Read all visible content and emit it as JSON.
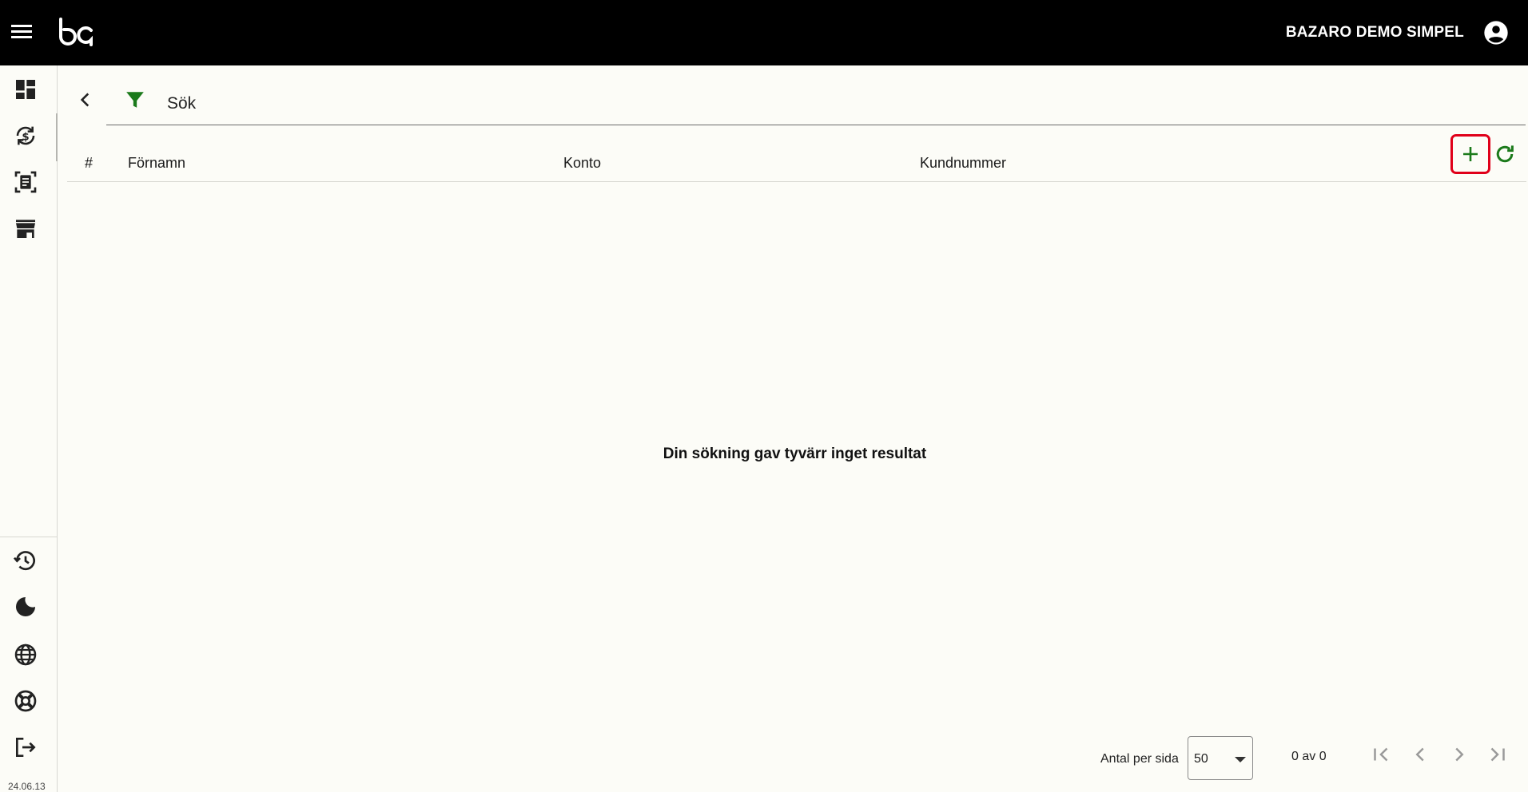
{
  "header": {
    "org_name": "BAZARO DEMO SIMPEL",
    "icons": {
      "menu": "menu-icon",
      "logo": "ba-logo",
      "account": "account-circle-icon"
    }
  },
  "sidebar": {
    "top_items": [
      {
        "icon": "dashboard-icon"
      },
      {
        "icon": "currency-exchange-icon"
      },
      {
        "icon": "document-scan-icon"
      },
      {
        "icon": "storefront-icon"
      }
    ],
    "bottom_items": [
      {
        "icon": "history-icon"
      },
      {
        "icon": "dark-mode-icon"
      },
      {
        "icon": "language-globe-icon"
      },
      {
        "icon": "support-lifebuoy-icon"
      },
      {
        "icon": "logout-icon"
      }
    ],
    "version": "24.06.13"
  },
  "search": {
    "label": "Sök"
  },
  "table": {
    "columns": [
      "#",
      "Förnamn",
      "Konto",
      "Kundnummer"
    ],
    "rows": [],
    "empty_message": "Din sökning gav tyvärr inget resultat"
  },
  "pagination": {
    "per_page_label": "Antal per sida",
    "per_page_value": "50",
    "range_text": "0 av 0"
  },
  "colors": {
    "topbar": "#000000",
    "background": "#fcfcf7",
    "accent_green": "#1b7a1b",
    "highlight_red": "#e0001a"
  }
}
